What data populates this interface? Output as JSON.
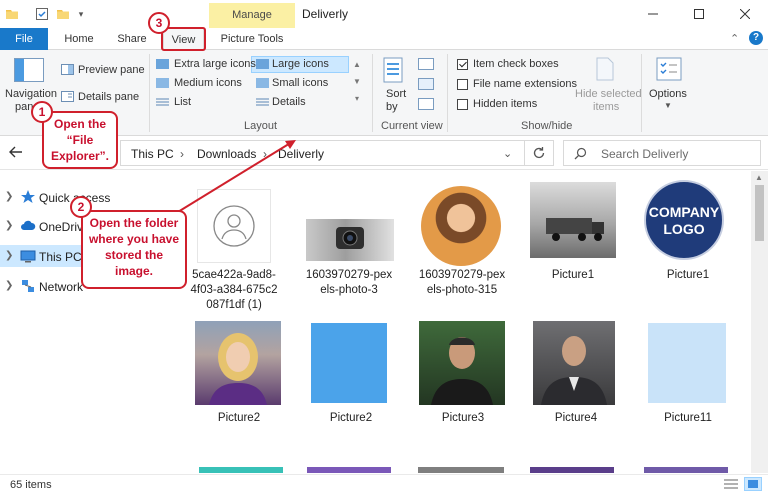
{
  "window": {
    "title": "Deliverly",
    "context_tab": "Manage",
    "colors": {
      "file_tab": "#1979ca",
      "context_tab": "#fbf0a4",
      "selection": "#cce8ff",
      "callout": "#d0202c"
    }
  },
  "tabs": {
    "file": "File",
    "home": "Home",
    "share": "Share",
    "view": "View",
    "picture_tools": "Picture Tools"
  },
  "ribbon": {
    "panes": {
      "navigation": "Navigation",
      "navigation_2": "pane",
      "preview": "Preview pane",
      "details": "Details pane"
    },
    "layout": {
      "extra_large": "Extra large icons",
      "large": "Large icons",
      "medium": "Medium icons",
      "small": "Small icons",
      "list": "List",
      "details": "Details",
      "group_label": "Layout"
    },
    "current_view": {
      "sort": "Sort",
      "sort_2": "by",
      "group_label": "Current view"
    },
    "show_hide": {
      "item_check_boxes": "Item check boxes",
      "file_name_extensions": "File name extensions",
      "hidden_items": "Hidden items",
      "hide_selected": "Hide selected",
      "hide_selected_2": "items",
      "group_label": "Show/hide"
    },
    "options": "Options"
  },
  "address": {
    "crumbs": [
      "This PC",
      "Downloads",
      "Deliverly"
    ],
    "search_placeholder": "Search Deliverly"
  },
  "nav": {
    "items": [
      {
        "label": "Quick access"
      },
      {
        "label": "OneDrive"
      },
      {
        "label": "This PC"
      },
      {
        "label": "Network"
      }
    ]
  },
  "files": [
    {
      "name_1": "5cae422a-9ad8-",
      "name_2": "4f03-a384-675c2",
      "name_3": "087f1df (1)"
    },
    {
      "name_1": "1603970279-pex",
      "name_2": "els-photo-3"
    },
    {
      "name_1": "1603970279-pex",
      "name_2": "els-photo-315"
    },
    {
      "name_1": "Picture1"
    },
    {
      "name_1": "Picture1",
      "logo_1": "COMPANY",
      "logo_2": "LOGO"
    },
    {
      "name_1": "Picture2"
    },
    {
      "name_1": "Picture2"
    },
    {
      "name_1": "Picture3"
    },
    {
      "name_1": "Picture4"
    },
    {
      "name_1": "Picture11"
    }
  ],
  "status": {
    "count": "65 items"
  },
  "callouts": {
    "one": {
      "num": "1",
      "line1": "Open the",
      "line2": "“File",
      "line3": "Explorer”."
    },
    "two": {
      "num": "2",
      "line1": "Open the folder",
      "line2": "where you have",
      "line3": "stored the",
      "line4": "image."
    },
    "three": {
      "num": "3"
    }
  }
}
